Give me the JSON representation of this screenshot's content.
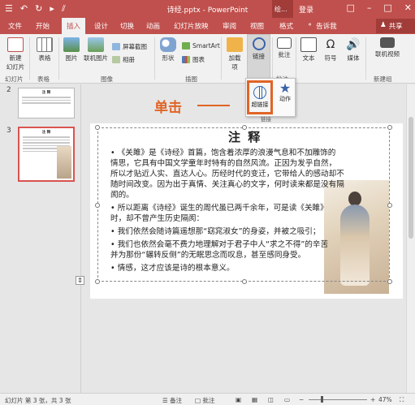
{
  "titlebar": {
    "qat": [
      "☰",
      "↶",
      "↻",
      "▸",
      "⫽"
    ],
    "title": "诗经.pptx - PowerPoint",
    "context_tool": "绘...",
    "login": "登录",
    "window_buttons": [
      "□",
      "–",
      "□",
      "✕"
    ]
  },
  "tabs": [
    "文件",
    "开始",
    "插入",
    "设计",
    "切换",
    "动画",
    "幻灯片放映",
    "审阅",
    "视图",
    "格式"
  ],
  "active_tab": "插入",
  "tell_me": "告诉我",
  "share": "共享",
  "ribbon": {
    "new_slide": "新建\n幻灯片",
    "table": "表格",
    "picture": "图片",
    "online_picture": "联机图片",
    "screenshot": "屏幕截图",
    "album": "相册",
    "shapes": "形状",
    "smartart": "SmartArt",
    "chart": "图表",
    "addins": "加载\n项",
    "links": "链接",
    "comment": "批注",
    "text": "文本",
    "symbols": "符号",
    "media": "媒体",
    "video_online": "联机视频",
    "groups": {
      "slides": "幻灯片",
      "tables": "表格",
      "images": "图像",
      "illustrations": "插图",
      "comments": "批注",
      "newgroup": "新建组"
    }
  },
  "slides_panel": {
    "numbers": [
      "2",
      "3"
    ],
    "slide2_title": "注 释",
    "slide3_title": "注 释"
  },
  "popup": {
    "hyperlink": "超链接",
    "action": "动作",
    "group": "链接"
  },
  "callout": "单击",
  "slide": {
    "title": "注 释",
    "paragraphs": [
      "•  《关雎》是《诗经》首篇，饱含着浓厚的浪漫气息和不加雕饰的",
      "情思，它具有中国文学童年时特有的自然风流。正因为发乎自然，",
      "所以才贴近人实、直达人心。历经时代的变迁，它带给人的感动却不",
      "随时间改变。因为出于真情、关注真心的文字，何时读来都是没有隔",
      "阂的。",
      "•      所以距离《诗经》诞生的周代虽已两千余年，可是读《关雎》",
      "时，却不曾产生历史隔阂：",
      "•       我们依然会随诗篇遥想那“窈窕淑女”的身姿，并被之吸引；",
      "•       我们也依然会毫不费力地理解对于君子中人“求之不得”的辛苦",
      "并为那份“辗转反侧”的无眠思念而叹息，甚至感同身受。",
      "•    情感，这才应该是诗的根本意义。"
    ]
  },
  "statusbar": {
    "slide_info": "幻灯片 第 3 张，共 3 张",
    "notes": "备注",
    "comments": "批注",
    "zoom": "47%",
    "zoom_level_pct": 47
  },
  "colors": {
    "brand": "#c0504d",
    "highlight": "#e06426"
  }
}
